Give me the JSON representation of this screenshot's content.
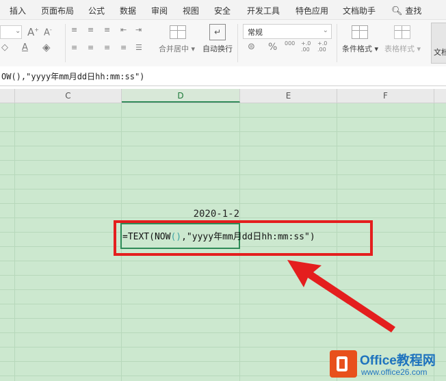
{
  "menu": {
    "items": [
      "插入",
      "页面布局",
      "公式",
      "数据",
      "审阅",
      "视图",
      "安全",
      "开发工具",
      "特色应用",
      "文档助手"
    ],
    "search_label": "查找"
  },
  "ribbon": {
    "number_format": "常规",
    "merge_center_label": "合并居中",
    "wrap_text_label": "自动换行",
    "conditional_format_label": "条件格式",
    "table_style_label": "表格样式",
    "doc_label": "文档",
    "percent_symbol": "%",
    "thousands_symbol": "000",
    "inc_decimal_symbol": "+.0 .00",
    "dec_decimal_symbol": "+.0 .00"
  },
  "formula_bar": {
    "text": "OW(),\"yyyy年mm月dd日hh:mm:ss\")"
  },
  "columns": [
    "C",
    "D",
    "E",
    "F"
  ],
  "active_column": "D",
  "cells": {
    "date_value": "2020-1-2",
    "formula_part1": "=TEXT(NOW",
    "formula_paren": "()",
    "formula_part2": ",\"yyyy年mm月dd日hh:mm:ss\")"
  },
  "annotation": {
    "highlight_color": "#e41e1e",
    "arrow_color": "#e41e1e"
  },
  "watermark": {
    "title": "Office教程网",
    "url": "www.office26.com",
    "logo_color": "#e8501c",
    "text_color": "#1e73be"
  },
  "theme": {
    "grid_background": "#cce8cf",
    "active_accent": "#2e8b57"
  }
}
